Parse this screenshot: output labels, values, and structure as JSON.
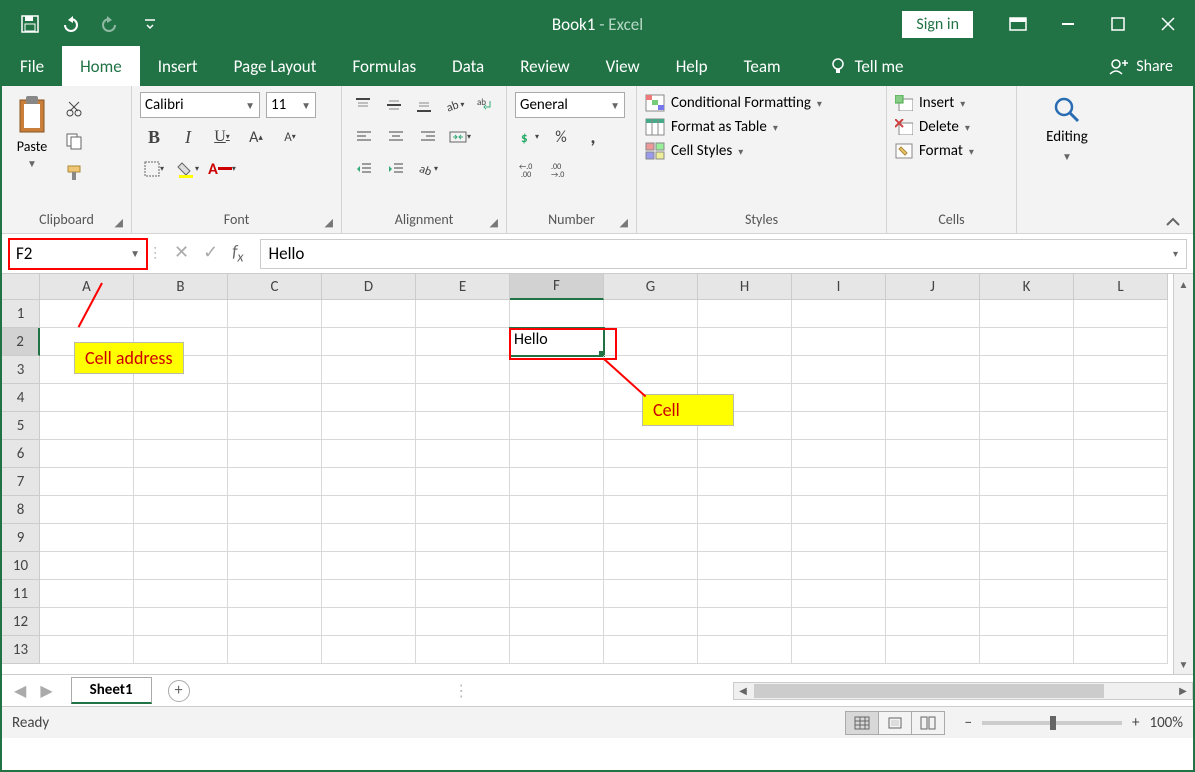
{
  "title": {
    "book": "Book1",
    "sep": "  -  ",
    "app": "Excel"
  },
  "signin": "Sign in",
  "tabs": [
    "File",
    "Home",
    "Insert",
    "Page Layout",
    "Formulas",
    "Data",
    "Review",
    "View",
    "Help",
    "Team"
  ],
  "active_tab": "Home",
  "tellme": "Tell me",
  "share": "Share",
  "ribbon": {
    "clipboard": {
      "paste": "Paste",
      "label": "Clipboard"
    },
    "font": {
      "name": "Calibri",
      "size": "11",
      "label": "Font"
    },
    "alignment": {
      "label": "Alignment"
    },
    "number": {
      "format": "General",
      "label": "Number"
    },
    "styles": {
      "cond": "Conditional Formatting",
      "table": "Format as Table",
      "cell": "Cell Styles",
      "label": "Styles"
    },
    "cells": {
      "insert": "Insert",
      "delete": "Delete",
      "format": "Format",
      "label": "Cells"
    },
    "editing": {
      "label": "Editing"
    }
  },
  "namebox": "F2",
  "formula": "Hello",
  "columns": [
    "A",
    "B",
    "C",
    "D",
    "E",
    "F",
    "G",
    "H",
    "I",
    "J",
    "K",
    "L"
  ],
  "rows": [
    "1",
    "2",
    "3",
    "4",
    "5",
    "6",
    "7",
    "8",
    "9",
    "10",
    "11",
    "12",
    "13"
  ],
  "selected_col_idx": 5,
  "selected_row_idx": 1,
  "cell_value": "Hello",
  "annotations": {
    "celladdr": "Cell address",
    "cell": "Cell"
  },
  "sheet": "Sheet1",
  "status": "Ready",
  "zoom": "100%"
}
